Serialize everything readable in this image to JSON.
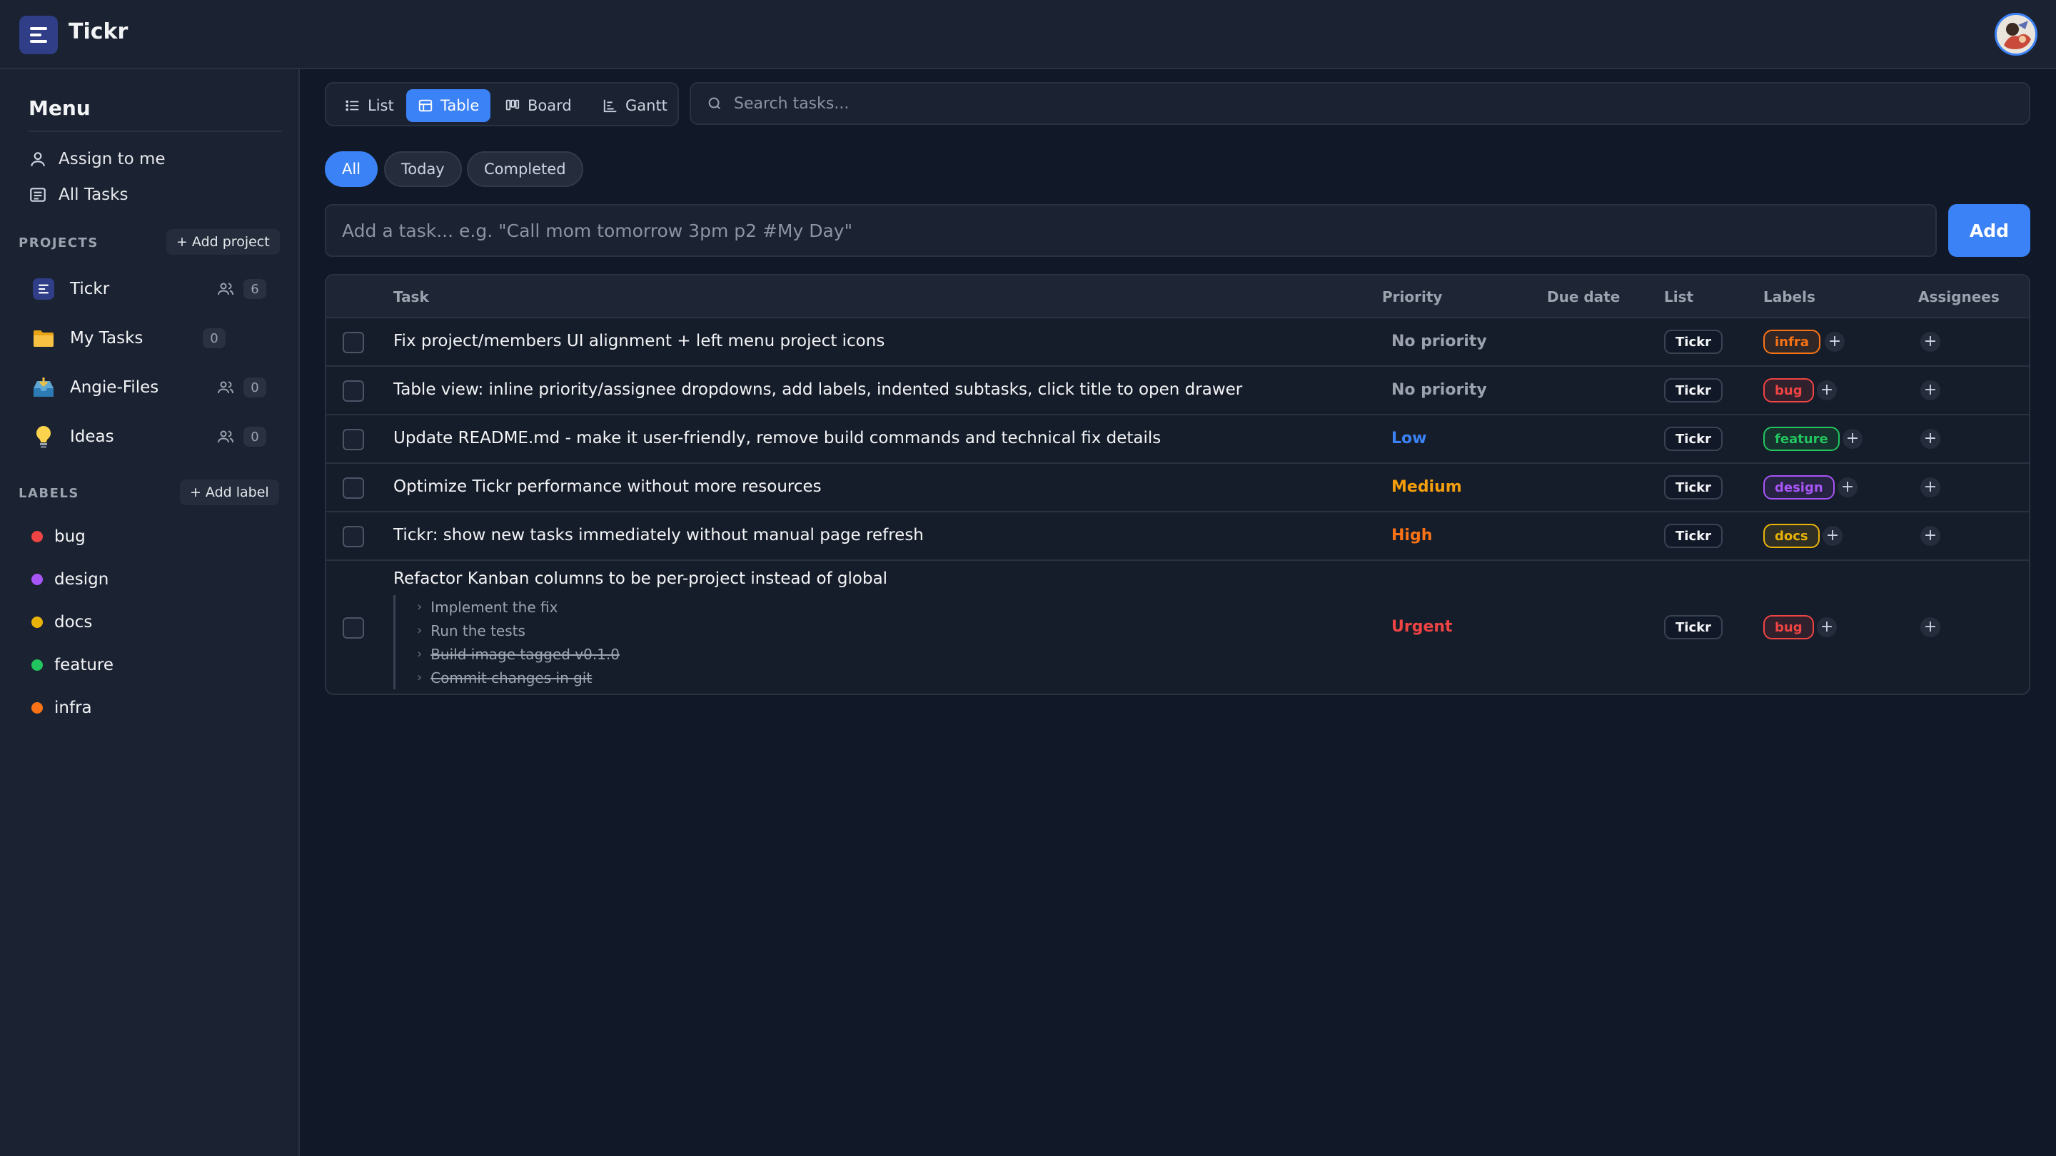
{
  "app": {
    "name": "Tickr"
  },
  "sidebar": {
    "menu_title": "Menu",
    "menu_items": [
      {
        "label": "Assign to me",
        "icon": "user-icon"
      },
      {
        "label": "All Tasks",
        "icon": "list-icon"
      }
    ],
    "projects_heading": "PROJECTS",
    "add_project_label": "Add project",
    "projects": [
      {
        "name": "Tickr",
        "icon": "tickr-logo-icon",
        "shared": true,
        "count": "6"
      },
      {
        "name": "My Tasks",
        "icon": "folder-icon",
        "shared": false,
        "count": "0"
      },
      {
        "name": "Angie-Files",
        "icon": "inbox-tray-icon",
        "shared": true,
        "count": "0"
      },
      {
        "name": "Ideas",
        "icon": "lightbulb-icon",
        "shared": true,
        "count": "0"
      }
    ],
    "labels_heading": "LABELS",
    "add_label_label": "Add label",
    "labels": [
      {
        "name": "bug",
        "color": "#ef4444"
      },
      {
        "name": "design",
        "color": "#a855f7"
      },
      {
        "name": "docs",
        "color": "#eab308"
      },
      {
        "name": "feature",
        "color": "#22c55e"
      },
      {
        "name": "infra",
        "color": "#f97316"
      }
    ]
  },
  "views": {
    "options": [
      "List",
      "Table",
      "Board",
      "Gantt"
    ],
    "active": "Table"
  },
  "search": {
    "placeholder": "Search tasks..."
  },
  "filters": {
    "options": [
      "All",
      "Today",
      "Completed"
    ],
    "active": "All"
  },
  "add_task": {
    "placeholder": "Add a task... e.g. \"Call mom tomorrow 3pm p2 #My Day\"",
    "button_label": "Add"
  },
  "table": {
    "columns": {
      "task": "Task",
      "priority": "Priority",
      "due_date": "Due date",
      "list": "List",
      "labels": "Labels",
      "assignees": "Assignees"
    },
    "rows": [
      {
        "title": "Fix project/members UI alignment + left menu project icons",
        "priority": "No priority",
        "priority_color": "#9ca3af",
        "due": "",
        "list": "Tickr",
        "label": "infra",
        "label_color": "#f97316"
      },
      {
        "title": "Table view: inline priority/assignee dropdowns, add labels, indented subtasks, click title to open drawer",
        "priority": "No priority",
        "priority_color": "#9ca3af",
        "due": "",
        "list": "Tickr",
        "label": "bug",
        "label_color": "#ef4444"
      },
      {
        "title": "Update README.md - make it user-friendly, remove build commands and technical fix details",
        "priority": "Low",
        "priority_color": "#3b82f6",
        "due": "",
        "list": "Tickr",
        "label": "feature",
        "label_color": "#22c55e"
      },
      {
        "title": "Optimize Tickr performance without more resources",
        "priority": "Medium",
        "priority_color": "#f59e0b",
        "due": "",
        "list": "Tickr",
        "label": "design",
        "label_color": "#a855f7"
      },
      {
        "title": "Tickr: show new tasks immediately without manual page refresh",
        "priority": "High",
        "priority_color": "#f97316",
        "due": "",
        "list": "Tickr",
        "label": "docs",
        "label_color": "#eab308"
      },
      {
        "title": "Refactor Kanban columns to be per-project instead of global",
        "priority": "Urgent",
        "priority_color": "#ef4444",
        "due": "",
        "list": "Tickr",
        "label": "bug",
        "label_color": "#ef4444",
        "subtasks": [
          {
            "title": "Implement the fix",
            "done": false
          },
          {
            "title": "Run the tests",
            "done": false
          },
          {
            "title": "Build image tagged v0.1.0",
            "done": true
          },
          {
            "title": "Commit changes in git",
            "done": true
          }
        ]
      }
    ]
  }
}
